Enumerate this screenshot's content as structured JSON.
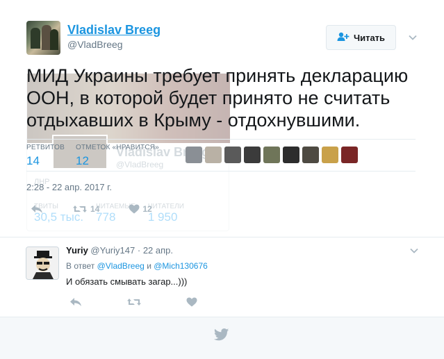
{
  "tweet": {
    "author_name": "Vladislav Breeg",
    "author_handle": "@VladBreeg",
    "follow_label": "Читать",
    "text": "МИД Украины требует принять декларацию ООН, в которой будет принято не считать отдыхавших в Крыму - отдохнувшими.",
    "retweets_label": "РЕТВИТОВ",
    "retweets_count": "14",
    "likes_label": "ОТМЕТОК «НРАВИТСЯ»",
    "likes_count": "12",
    "timestamp": "2:28 - 22 апр. 2017 г.",
    "action_retweet_count": "14",
    "action_like_count": "12",
    "liker_colors": [
      "#8a8f95",
      "#b9b1a5",
      "#5a5a5a",
      "#3b3b3b",
      "#6f7559",
      "#2d2d2d",
      "#4e4a42",
      "#c9a14a",
      "#7a2626"
    ]
  },
  "ghost_card": {
    "name": "Vladislav Breeg",
    "handle": "@VladBreeg",
    "location": "ЛНР",
    "stats": [
      {
        "label": "ТВИТЫ",
        "value": "30,5 тыс."
      },
      {
        "label": "ЧИТАЕМЫЕ",
        "value": "778"
      },
      {
        "label": "ЧИТАТЕЛИ",
        "value": "1 950"
      }
    ]
  },
  "reply": {
    "author_name": "Yuriy",
    "author_handle": "@Yuriy147",
    "date": "22 апр.",
    "reply_prefix": "В ответ",
    "reply_to_1": "@VladBreeg",
    "reply_conj": "и",
    "reply_to_2": "@Mich130676",
    "text": "И обязать смывать загар...)))"
  },
  "icons": {
    "follow": "add-user-icon",
    "more": "chevron-down-icon",
    "reply": "reply-icon",
    "retweet": "retweet-icon",
    "like": "heart-icon",
    "footer": "twitter-bird-icon"
  },
  "colors": {
    "link_blue": "#1b95e0",
    "muted": "#657786",
    "icon_grey": "#aab8c2",
    "footer_bg": "#f5f8fa"
  }
}
